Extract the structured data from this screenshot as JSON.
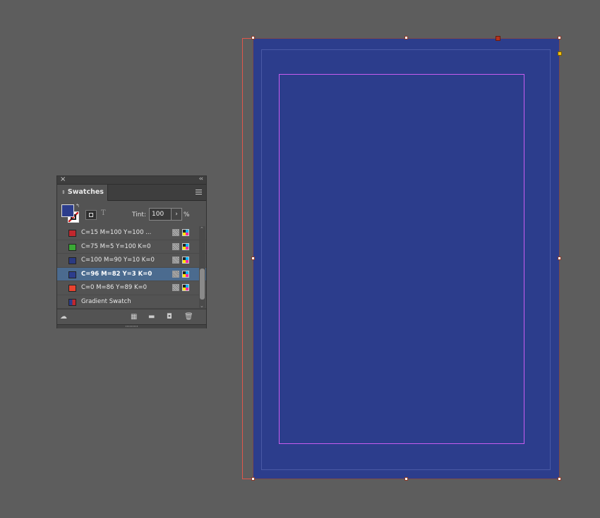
{
  "panel": {
    "title": "Swatches",
    "close_glyph": "×",
    "collapse_glyph": "‹‹",
    "tint_label": "Tint:",
    "tint_value": "100",
    "tint_unit": "%",
    "fill_color": "#2c3d8c",
    "text_format_glyph": "T",
    "swatches": [
      {
        "label": "C=15 M=100 Y=100 ...",
        "color": "#c1272d",
        "selected": false
      },
      {
        "label": "C=75 M=5 Y=100 K=0",
        "color": "#3aa935",
        "selected": false
      },
      {
        "label": "C=100 M=90 Y=10 K=0",
        "color": "#2b3a82",
        "selected": false
      },
      {
        "label": "C=96 M=82 Y=3 K=0",
        "color": "#2c3d8c",
        "selected": true
      },
      {
        "label": "C=0 M=86 Y=89 K=0",
        "color": "#e8432f",
        "selected": false
      },
      {
        "label": "Gradient Swatch",
        "color": "gradient",
        "selected": false
      }
    ],
    "footer_icons": [
      "cloud-sync-icon",
      "swatch-views-icon",
      "new-color-group-icon",
      "new-swatch-icon",
      "delete-swatch-icon"
    ]
  },
  "document": {
    "page_color": "#2c3d8c",
    "margin_guide_color": "#c95cf0",
    "bleed_guide_color": "#e0574c"
  }
}
